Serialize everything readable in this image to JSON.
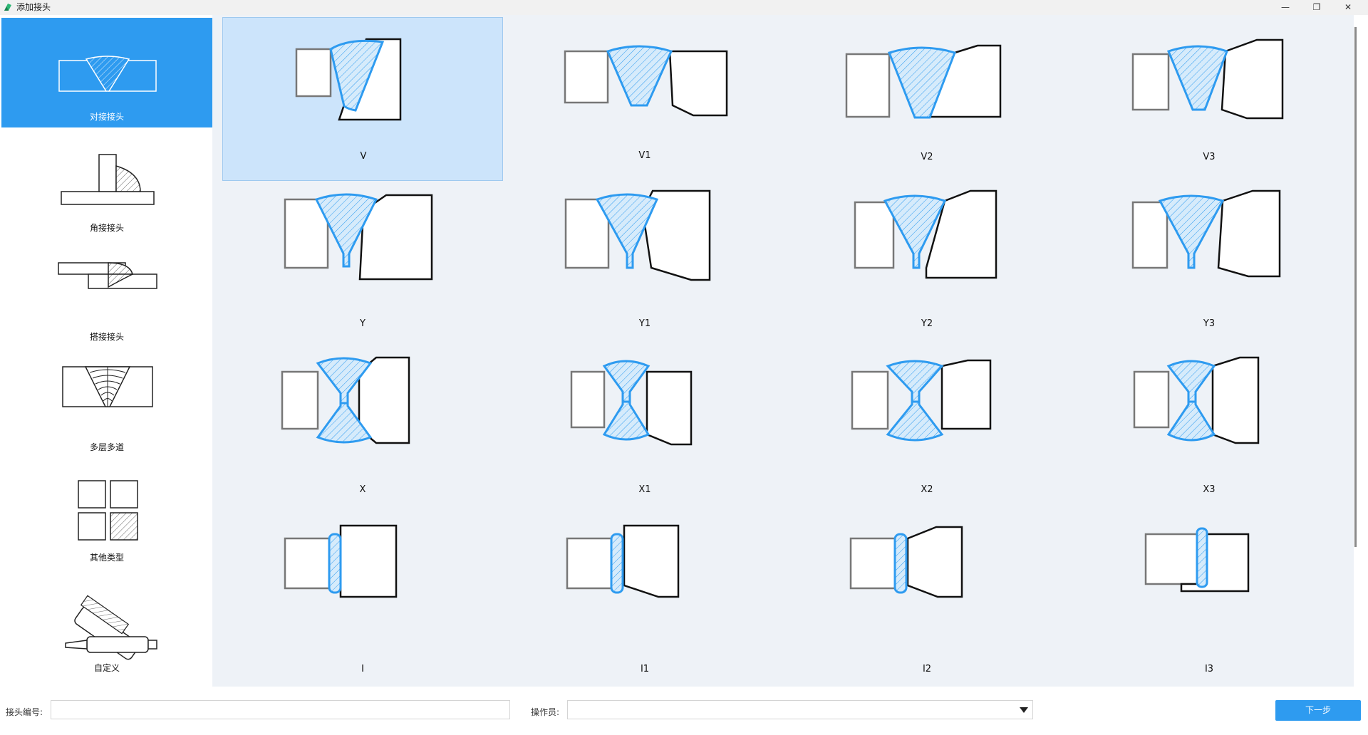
{
  "window": {
    "title": "添加接头",
    "minimize": "—",
    "restore": "❐",
    "close": "✕"
  },
  "sidebar": {
    "items": [
      {
        "label": "对接接头",
        "icon": "butt-joint-icon",
        "active": true
      },
      {
        "label": "角接接头",
        "icon": "corner-joint-icon",
        "active": false
      },
      {
        "label": "搭接接头",
        "icon": "lap-joint-icon",
        "active": false
      },
      {
        "label": "多层多道",
        "icon": "multi-pass-icon",
        "active": false
      },
      {
        "label": "其他类型",
        "icon": "other-types-icon",
        "active": false
      },
      {
        "label": "自定义",
        "icon": "custom-torch-icon",
        "active": false
      }
    ]
  },
  "grid": {
    "selected": "V",
    "tiles": [
      {
        "label": "V"
      },
      {
        "label": "V1"
      },
      {
        "label": "V2"
      },
      {
        "label": "V3"
      },
      {
        "label": "Y"
      },
      {
        "label": "Y1"
      },
      {
        "label": "Y2"
      },
      {
        "label": "Y3"
      },
      {
        "label": "X"
      },
      {
        "label": "X1"
      },
      {
        "label": "X2"
      },
      {
        "label": "X3"
      },
      {
        "label": "I"
      },
      {
        "label": "I1"
      },
      {
        "label": "I2"
      },
      {
        "label": "I3"
      }
    ]
  },
  "form": {
    "joint_id_label": "接头编号:",
    "joint_id_value": "",
    "operator_label": "操作员:",
    "operator_value": ""
  },
  "actions": {
    "next_label": "下一步"
  },
  "colors": {
    "accent": "#2e9bf0",
    "selected_tile": "#cce4fb",
    "main_bg": "#eef2f7",
    "weld_fill": "#d6ebfb"
  }
}
